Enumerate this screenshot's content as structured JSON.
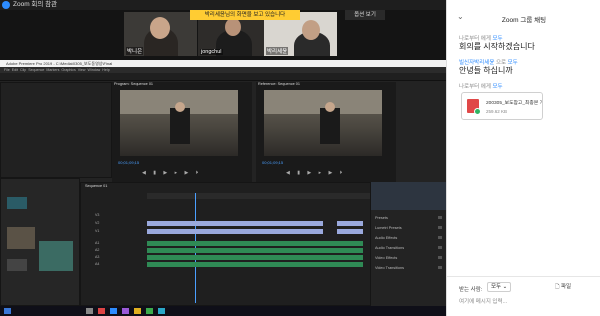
{
  "window": {
    "title": "Zoom 회의 참관"
  },
  "gallery": {
    "share_banner": "박리세윤님의 화면을 보고 있습니다",
    "view_options": "옵션 보기",
    "participants": [
      {
        "name": "박니은"
      },
      {
        "name": "jongchul"
      },
      {
        "name": "박리세윤"
      }
    ]
  },
  "premiere": {
    "title_bar": "Adobe Premiere Pro 2019 - C:\\Media\\0305_보도동영상\\Final",
    "menu": [
      "File",
      "Edit",
      "Clip",
      "Sequence",
      "Markers",
      "Graphics",
      "View",
      "Window",
      "Help"
    ],
    "source_monitor_label": "Program: Sequence 01",
    "program_monitor_label": "Reference: Sequence 01",
    "left_timecode": "00;01;09;15",
    "right_timecode": "00;01;09;15",
    "sequence_tab": "Sequence 01",
    "track_labels": [
      "V3",
      "V2",
      "V1",
      "A1",
      "A2",
      "A3",
      "A4"
    ],
    "effects": [
      "Presets",
      "Lumetri Presets",
      "Audio Effects",
      "Audio Transitions",
      "Video Effects",
      "Video Transitions"
    ]
  },
  "chat": {
    "title": "Zoom 그룹 채팅",
    "messages": [
      {
        "from": "나로부터",
        "to": "모두",
        "connector": "에게",
        "text": "회의를 시작하겠습니다"
      },
      {
        "from": "빌신자박리세윤",
        "to": "모두",
        "connector": "으로",
        "text": "안녕들 하십니까"
      },
      {
        "from": "나로부터",
        "to": "모두",
        "connector": "에게",
        "text": ""
      }
    ],
    "file": {
      "name": "200305_보도참고_최종본 개정...",
      "size": "259.62 KB"
    },
    "footer": {
      "recipient_label": "받는 사람:",
      "recipient_value": "모두",
      "file_button": "파일",
      "input_placeholder": "여기에 메시지 입력..."
    }
  },
  "colors": {
    "zoom_blue": "#2d8cff",
    "banner_yellow": "#ffcc33",
    "clip_video": "#9aa9dd",
    "clip_audio": "#2f8a55"
  }
}
